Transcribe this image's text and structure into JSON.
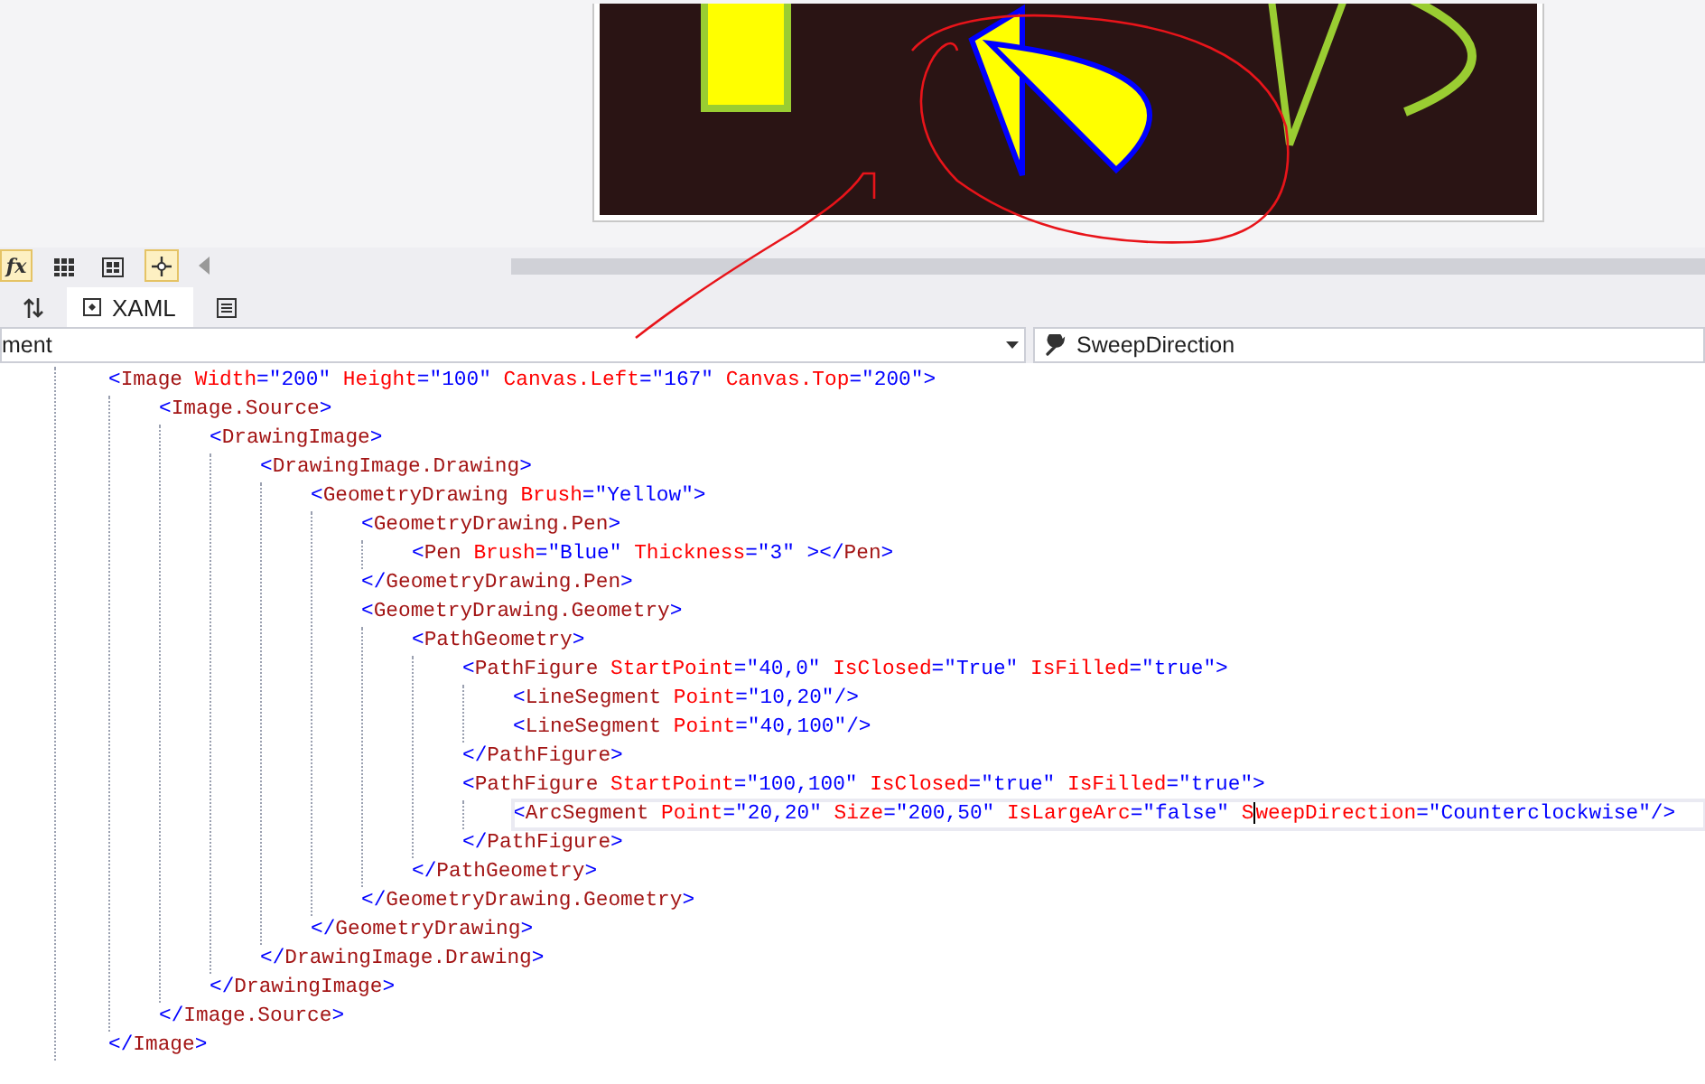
{
  "toolbar": {
    "buttons": [
      {
        "kind": "fx",
        "label": "fx",
        "selected": true
      },
      {
        "kind": "grid",
        "selected": false
      },
      {
        "kind": "snapgrid",
        "selected": false
      },
      {
        "kind": "snap",
        "selected": true
      }
    ]
  },
  "tabs": [
    {
      "kind": "swap",
      "selected": false
    },
    {
      "kind": "xaml",
      "label": "XAML",
      "selected": true
    },
    {
      "kind": "outline",
      "selected": false
    }
  ],
  "selectors": {
    "element": {
      "value": "ment"
    },
    "member": {
      "value": "SweepDirection"
    }
  },
  "editor": {
    "lines": [
      {
        "current": false,
        "tokens": [
          {
            "kind": "punct",
            "text": "<"
          },
          {
            "kind": "element",
            "text": "Image"
          },
          {
            "kind": "attribute",
            "text": " Width"
          },
          {
            "kind": "punct",
            "text": "=\"200\""
          },
          {
            "kind": "attribute",
            "text": " Height"
          },
          {
            "kind": "punct",
            "text": "=\"100\""
          },
          {
            "kind": "attribute",
            "text": " Canvas.Left"
          },
          {
            "kind": "punct",
            "text": "=\"167\""
          },
          {
            "kind": "attribute",
            "text": " Canvas.Top"
          },
          {
            "kind": "punct",
            "text": "=\"200\">"
          }
        ],
        "children": [
          {
            "current": false,
            "tokens": [
              {
                "kind": "punct",
                "text": "<"
              },
              {
                "kind": "element",
                "text": "Image.Source"
              },
              {
                "kind": "punct",
                "text": ">"
              }
            ],
            "children": [
              {
                "current": false,
                "tokens": [
                  {
                    "kind": "punct",
                    "text": "<"
                  },
                  {
                    "kind": "element",
                    "text": "DrawingImage"
                  },
                  {
                    "kind": "punct",
                    "text": ">"
                  }
                ],
                "children": [
                  {
                    "current": false,
                    "tokens": [
                      {
                        "kind": "punct",
                        "text": "<"
                      },
                      {
                        "kind": "element",
                        "text": "DrawingImage.Drawing"
                      },
                      {
                        "kind": "punct",
                        "text": ">"
                      }
                    ],
                    "children": [
                      {
                        "current": false,
                        "tokens": [
                          {
                            "kind": "punct",
                            "text": "<"
                          },
                          {
                            "kind": "element",
                            "text": "GeometryDrawing"
                          },
                          {
                            "kind": "attribute",
                            "text": " Brush"
                          },
                          {
                            "kind": "punct",
                            "text": "=\"Yellow\">"
                          }
                        ],
                        "children": [
                          {
                            "current": false,
                            "tokens": [
                              {
                                "kind": "punct",
                                "text": "<"
                              },
                              {
                                "kind": "element",
                                "text": "GeometryDrawing.Pen"
                              },
                              {
                                "kind": "punct",
                                "text": ">"
                              }
                            ],
                            "children": [
                              {
                                "current": false,
                                "tokens": [
                                  {
                                    "kind": "punct",
                                    "text": "<"
                                  },
                                  {
                                    "kind": "element",
                                    "text": "Pen"
                                  },
                                  {
                                    "kind": "attribute",
                                    "text": " Brush"
                                  },
                                  {
                                    "kind": "punct",
                                    "text": "=\"Blue\""
                                  },
                                  {
                                    "kind": "attribute",
                                    "text": " Thickness"
                                  },
                                  {
                                    "kind": "punct",
                                    "text": "=\"3\" ></"
                                  },
                                  {
                                    "kind": "element",
                                    "text": "Pen"
                                  },
                                  {
                                    "kind": "punct",
                                    "text": ">"
                                  }
                                ]
                              }
                            ]
                          },
                          {
                            "current": false,
                            "tokens": [
                              {
                                "kind": "punct",
                                "text": "</"
                              },
                              {
                                "kind": "element",
                                "text": "GeometryDrawing.Pen"
                              },
                              {
                                "kind": "punct",
                                "text": ">"
                              }
                            ]
                          },
                          {
                            "current": false,
                            "tokens": [
                              {
                                "kind": "punct",
                                "text": "<"
                              },
                              {
                                "kind": "element",
                                "text": "GeometryDrawing.Geometry"
                              },
                              {
                                "kind": "punct",
                                "text": ">"
                              }
                            ],
                            "children": [
                              {
                                "current": false,
                                "tokens": [
                                  {
                                    "kind": "punct",
                                    "text": "<"
                                  },
                                  {
                                    "kind": "element",
                                    "text": "PathGeometry"
                                  },
                                  {
                                    "kind": "punct",
                                    "text": ">"
                                  }
                                ],
                                "children": [
                                  {
                                    "current": false,
                                    "tokens": [
                                      {
                                        "kind": "punct",
                                        "text": "<"
                                      },
                                      {
                                        "kind": "element",
                                        "text": "PathFigure"
                                      },
                                      {
                                        "kind": "attribute",
                                        "text": " StartPoint"
                                      },
                                      {
                                        "kind": "punct",
                                        "text": "=\"40,0\""
                                      },
                                      {
                                        "kind": "attribute",
                                        "text": " IsClosed"
                                      },
                                      {
                                        "kind": "punct",
                                        "text": "=\"True\""
                                      },
                                      {
                                        "kind": "attribute",
                                        "text": " IsFilled"
                                      },
                                      {
                                        "kind": "punct",
                                        "text": "=\"true\">"
                                      }
                                    ],
                                    "children": [
                                      {
                                        "current": false,
                                        "tokens": [
                                          {
                                            "kind": "punct",
                                            "text": "<"
                                          },
                                          {
                                            "kind": "element",
                                            "text": "LineSegment"
                                          },
                                          {
                                            "kind": "attribute",
                                            "text": " Point"
                                          },
                                          {
                                            "kind": "punct",
                                            "text": "=\"10,20\"/>"
                                          }
                                        ]
                                      },
                                      {
                                        "current": false,
                                        "tokens": [
                                          {
                                            "kind": "punct",
                                            "text": "<"
                                          },
                                          {
                                            "kind": "element",
                                            "text": "LineSegment"
                                          },
                                          {
                                            "kind": "attribute",
                                            "text": " Point"
                                          },
                                          {
                                            "kind": "punct",
                                            "text": "=\"40,100\"/>"
                                          }
                                        ]
                                      }
                                    ]
                                  },
                                  {
                                    "current": false,
                                    "tokens": [
                                      {
                                        "kind": "punct",
                                        "text": "</"
                                      },
                                      {
                                        "kind": "element",
                                        "text": "PathFigure"
                                      },
                                      {
                                        "kind": "punct",
                                        "text": ">"
                                      }
                                    ]
                                  },
                                  {
                                    "current": false,
                                    "tokens": [
                                      {
                                        "kind": "punct",
                                        "text": "<"
                                      },
                                      {
                                        "kind": "element",
                                        "text": "PathFigure"
                                      },
                                      {
                                        "kind": "attribute",
                                        "text": " StartPoint"
                                      },
                                      {
                                        "kind": "punct",
                                        "text": "=\"100,100\""
                                      },
                                      {
                                        "kind": "attribute",
                                        "text": " IsClosed"
                                      },
                                      {
                                        "kind": "punct",
                                        "text": "=\"true\""
                                      },
                                      {
                                        "kind": "attribute",
                                        "text": " IsFilled"
                                      },
                                      {
                                        "kind": "punct",
                                        "text": "=\"true\">"
                                      }
                                    ],
                                    "children": [
                                      {
                                        "current": true,
                                        "tokens": [
                                          {
                                            "kind": "punct",
                                            "text": "<"
                                          },
                                          {
                                            "kind": "element",
                                            "text": "ArcSegment"
                                          },
                                          {
                                            "kind": "attribute",
                                            "text": " Point"
                                          },
                                          {
                                            "kind": "punct",
                                            "text": "=\"20,20\""
                                          },
                                          {
                                            "kind": "attribute",
                                            "text": " Size"
                                          },
                                          {
                                            "kind": "punct",
                                            "text": "=\"200,50\""
                                          },
                                          {
                                            "kind": "attribute",
                                            "text": " IsLargeArc"
                                          },
                                          {
                                            "kind": "punct",
                                            "text": "=\"false\""
                                          },
                                          {
                                            "kind": "attribute",
                                            "text": " S"
                                          },
                                          {
                                            "kind": "caret"
                                          },
                                          {
                                            "kind": "attribute",
                                            "text": "weepDirection"
                                          },
                                          {
                                            "kind": "punct",
                                            "text": "=\"Counterclockwise\"/>"
                                          }
                                        ]
                                      }
                                    ]
                                  },
                                  {
                                    "current": false,
                                    "tokens": [
                                      {
                                        "kind": "punct",
                                        "text": "</"
                                      },
                                      {
                                        "kind": "element",
                                        "text": "PathFigure"
                                      },
                                      {
                                        "kind": "punct",
                                        "text": ">"
                                      }
                                    ]
                                  }
                                ]
                              },
                              {
                                "current": false,
                                "tokens": [
                                  {
                                    "kind": "punct",
                                    "text": "</"
                                  },
                                  {
                                    "kind": "element",
                                    "text": "PathGeometry"
                                  },
                                  {
                                    "kind": "punct",
                                    "text": ">"
                                  }
                                ]
                              }
                            ]
                          },
                          {
                            "current": false,
                            "tokens": [
                              {
                                "kind": "punct",
                                "text": "</"
                              },
                              {
                                "kind": "element",
                                "text": "GeometryDrawing.Geometry"
                              },
                              {
                                "kind": "punct",
                                "text": ">"
                              }
                            ]
                          }
                        ]
                      },
                      {
                        "current": false,
                        "tokens": [
                          {
                            "kind": "punct",
                            "text": "</"
                          },
                          {
                            "kind": "element",
                            "text": "GeometryDrawing"
                          },
                          {
                            "kind": "punct",
                            "text": ">"
                          }
                        ]
                      }
                    ]
                  },
                  {
                    "current": false,
                    "tokens": [
                      {
                        "kind": "punct",
                        "text": "</"
                      },
                      {
                        "kind": "element",
                        "text": "DrawingImage.Drawing"
                      },
                      {
                        "kind": "punct",
                        "text": ">"
                      }
                    ]
                  }
                ]
              },
              {
                "current": false,
                "tokens": [
                  {
                    "kind": "punct",
                    "text": "</"
                  },
                  {
                    "kind": "element",
                    "text": "DrawingImage"
                  },
                  {
                    "kind": "punct",
                    "text": ">"
                  }
                ]
              }
            ]
          },
          {
            "current": false,
            "tokens": [
              {
                "kind": "punct",
                "text": "</"
              },
              {
                "kind": "element",
                "text": "Image.Source"
              },
              {
                "kind": "punct",
                "text": ">"
              }
            ]
          }
        ]
      },
      {
        "current": false,
        "tokens": [
          {
            "kind": "punct",
            "text": "</"
          },
          {
            "kind": "element",
            "text": "Image"
          },
          {
            "kind": "punct",
            "text": ">"
          }
        ]
      }
    ]
  }
}
